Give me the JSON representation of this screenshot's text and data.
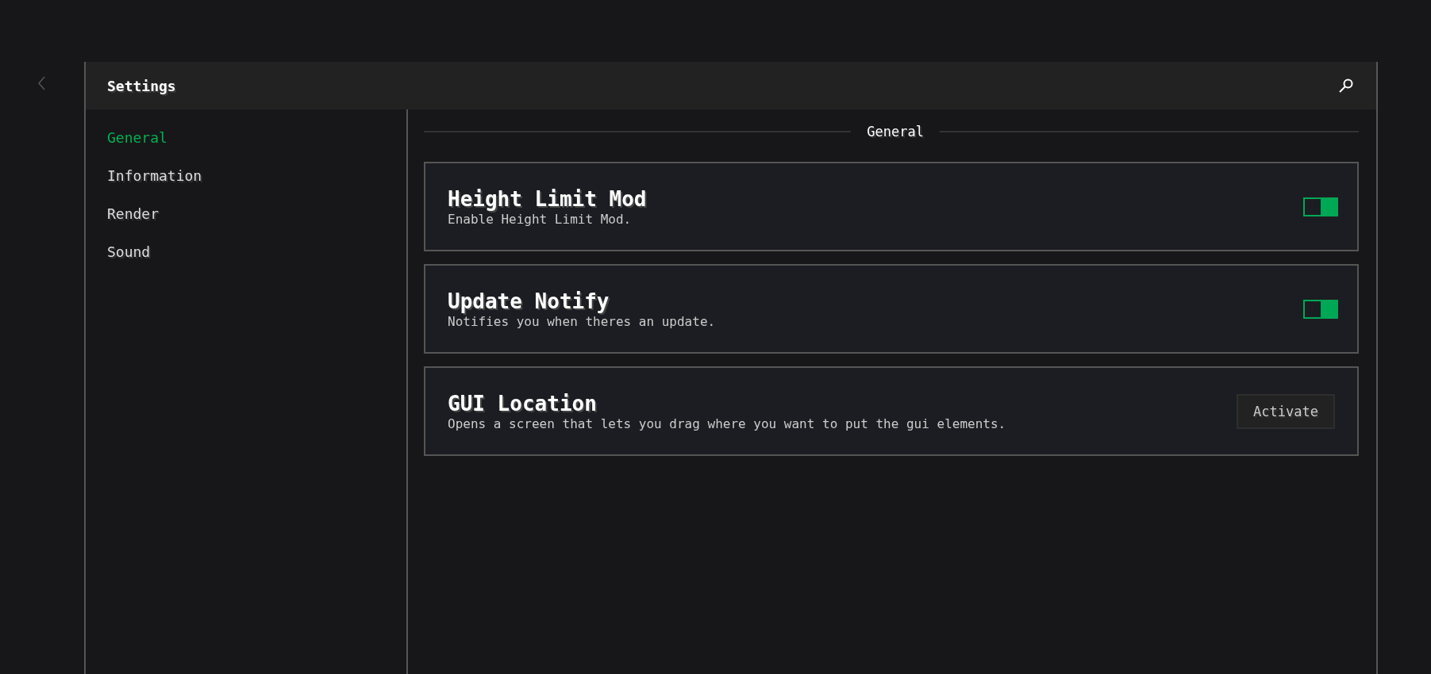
{
  "window": {
    "title": "Settings"
  },
  "sidebar": {
    "items": [
      {
        "label": "General",
        "selected": true
      },
      {
        "label": "Information",
        "selected": false
      },
      {
        "label": "Render",
        "selected": false
      },
      {
        "label": "Sound",
        "selected": false
      }
    ]
  },
  "section": {
    "title": "General"
  },
  "settings": [
    {
      "kind": "toggle",
      "title": "Height Limit Mod",
      "description": "Enable Height Limit Mod.",
      "on": true
    },
    {
      "kind": "toggle",
      "title": "Update Notify",
      "description": "Notifies you when theres an update.",
      "on": true
    },
    {
      "kind": "button",
      "title": "GUI Location",
      "description": "Opens a screen that lets you drag where you want to put the gui elements.",
      "button": "Activate"
    }
  ]
}
